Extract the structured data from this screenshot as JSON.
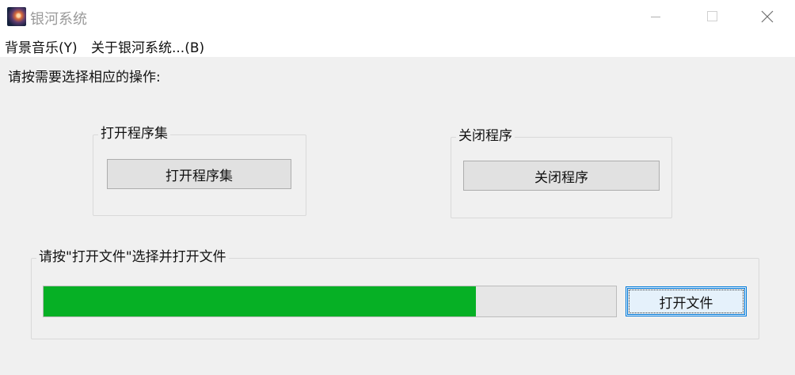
{
  "window": {
    "title": "银河系统",
    "icon": "galaxy-icon",
    "controls": [
      "minimize-icon",
      "maximize-icon",
      "close-icon"
    ]
  },
  "menu": {
    "items": [
      {
        "label": "背景音乐(Y)"
      },
      {
        "label": "关于银河系统...(B)"
      }
    ]
  },
  "main": {
    "instruction": "请按需要选择相应的操作:",
    "open_group": {
      "label": "打开程序集",
      "button": "打开程序集"
    },
    "close_group": {
      "label": "关闭程序",
      "button": "关闭程序"
    },
    "file_group": {
      "label": "请按\"打开文件\"选择并打开文件",
      "progress_fraction": 0.755,
      "progress_color": "#06b025",
      "button": "打开文件"
    }
  }
}
